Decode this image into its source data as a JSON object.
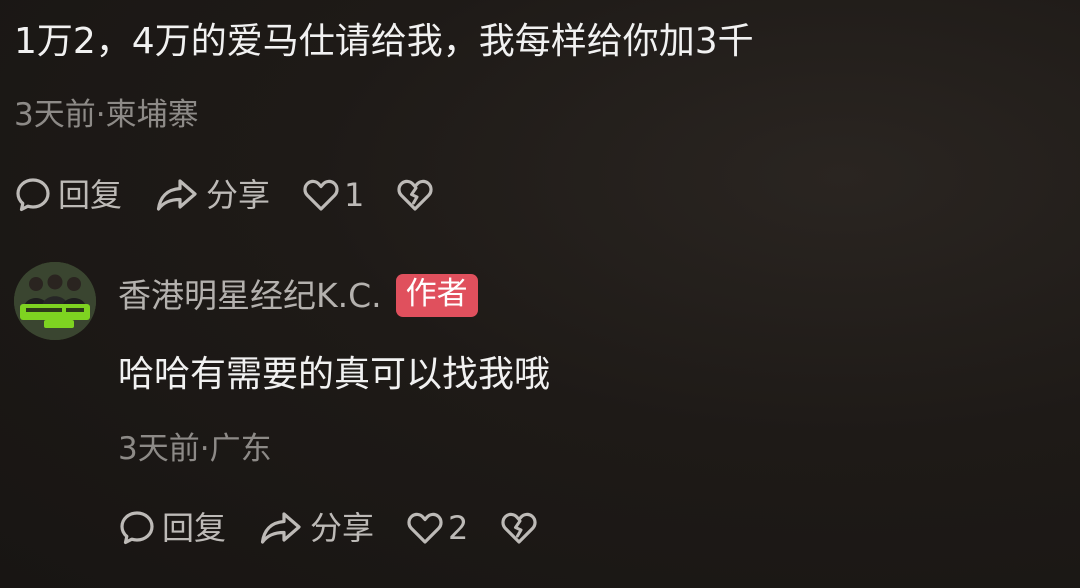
{
  "comment1": {
    "text": "1万2，4万的爱马仕请给我，我每样给你加3千",
    "meta": "3天前·柬埔寨",
    "reply_label": "回复",
    "share_label": "分享",
    "like_count": "1"
  },
  "comment2": {
    "username": "香港明星经纪K.C.",
    "badge": "作者",
    "text": "哈哈有需要的真可以找我哦",
    "meta": "3天前·广东",
    "reply_label": "回复",
    "share_label": "分享",
    "like_count": "2"
  },
  "icons": {
    "reply": "speech-bubble-icon",
    "share": "share-arrow-icon",
    "like": "heart-icon",
    "dislike": "broken-heart-icon",
    "avatar": "user-avatar"
  },
  "colors": {
    "background": "#1e1a17",
    "primary_text": "#f1f1f1",
    "secondary_text": "#8d8a87",
    "action_text": "#bdbab7",
    "author_badge": "#e0505d",
    "avatar_accent": "#7ed321"
  }
}
